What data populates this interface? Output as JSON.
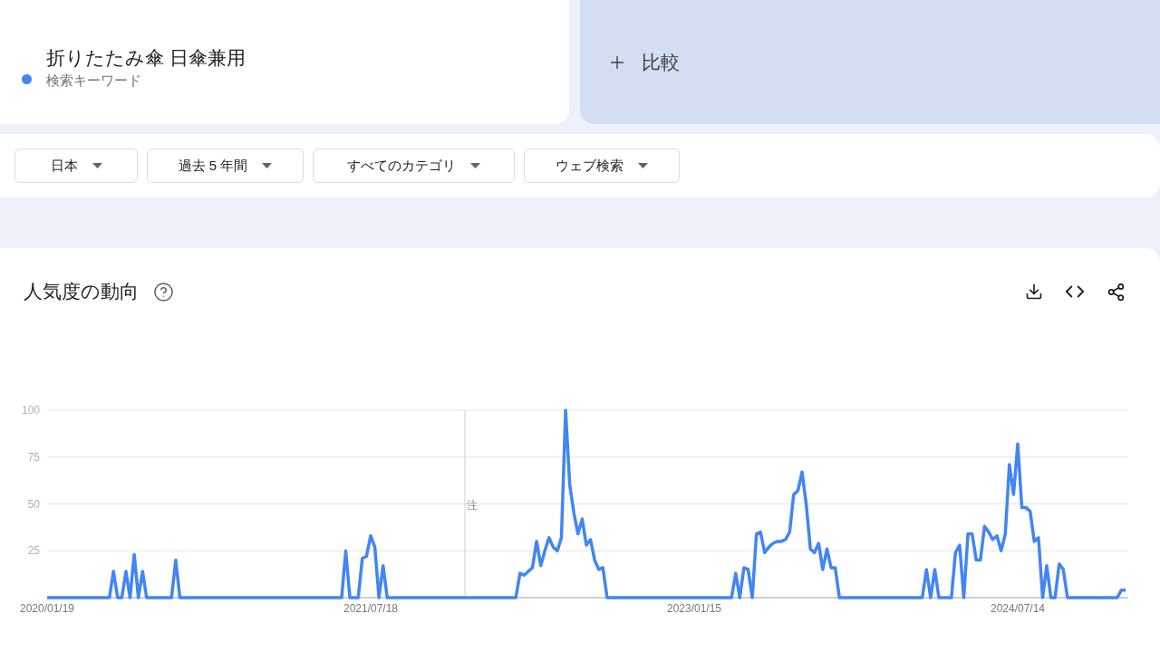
{
  "search_term": {
    "sublabel": "検索キーワード"
  },
  "compare": {
    "label": "比較"
  },
  "filters": [
    {
      "label": "日本"
    },
    {
      "label": "過去 5 年間"
    },
    {
      "label": "すべてのカテゴリ"
    },
    {
      "label": "ウェブ検索"
    }
  ],
  "chart": {
    "title": "人気度の動向",
    "chart_data": {
      "type": "line",
      "grid": true,
      "ylim": [
        0,
        100
      ],
      "yticks": [
        25,
        50,
        75,
        100
      ],
      "categories": [
        "2020/01/19",
        null,
        null,
        null,
        null,
        null,
        null,
        null,
        null,
        null,
        null,
        null,
        null,
        null,
        null,
        null,
        null,
        null,
        null,
        null,
        null,
        null,
        null,
        null,
        null,
        null,
        null,
        null,
        null,
        null,
        null,
        null,
        null,
        null,
        null,
        null,
        null,
        null,
        null,
        null,
        null,
        null,
        null,
        null,
        null,
        null,
        null,
        null,
        null,
        null,
        null,
        null,
        null,
        null,
        null,
        null,
        null,
        null,
        null,
        null,
        null,
        null,
        null,
        null,
        null,
        null,
        null,
        null,
        null,
        null,
        null,
        null,
        null,
        null,
        null,
        null,
        null,
        null,
        "2021/07/18",
        null,
        null,
        null,
        null,
        null,
        null,
        null,
        null,
        null,
        null,
        null,
        null,
        null,
        null,
        null,
        null,
        null,
        null,
        null,
        null,
        null,
        null,
        null,
        null,
        null,
        null,
        null,
        null,
        null,
        null,
        null,
        null,
        null,
        null,
        null,
        null,
        null,
        null,
        null,
        null,
        null,
        null,
        null,
        null,
        null,
        null,
        null,
        null,
        null,
        null,
        null,
        null,
        null,
        null,
        null,
        null,
        null,
        null,
        null,
        null,
        null,
        null,
        null,
        null,
        null,
        null,
        null,
        null,
        null,
        null,
        null,
        null,
        null,
        null,
        null,
        null,
        null,
        "2023/01/15",
        null,
        null,
        null,
        null,
        null,
        null,
        null,
        null,
        null,
        null,
        null,
        null,
        null,
        null,
        null,
        null,
        null,
        null,
        null,
        null,
        null,
        null,
        null,
        null,
        null,
        null,
        null,
        null,
        null,
        null,
        null,
        null,
        null,
        null,
        null,
        null,
        null,
        null,
        null,
        null,
        null,
        null,
        null,
        null,
        null,
        null,
        null,
        null,
        null,
        null,
        null,
        null,
        null,
        null,
        null,
        null,
        null,
        null,
        null,
        null,
        null,
        null,
        null,
        null,
        null,
        null,
        null,
        null,
        null,
        null,
        null,
        null,
        null,
        null,
        null,
        null,
        null,
        "2024/07/14",
        null,
        null,
        null,
        null,
        null,
        null,
        null,
        null,
        null,
        null,
        null,
        null,
        null,
        null,
        null,
        null,
        null,
        null,
        null,
        null,
        null,
        null,
        null,
        null,
        null,
        null
      ],
      "annotations": [
        "注"
      ],
      "series": [
        {
          "name": "折りたたみ傘 日傘兼用",
          "color": "#4285f4",
          "values": [
            0,
            0,
            0,
            0,
            0,
            0,
            0,
            0,
            0,
            0,
            0,
            0,
            0,
            0,
            0,
            0,
            14,
            0,
            0,
            14,
            0,
            23,
            0,
            14,
            0,
            0,
            0,
            0,
            0,
            0,
            0,
            20,
            0,
            0,
            0,
            0,
            0,
            0,
            0,
            0,
            0,
            0,
            0,
            0,
            0,
            0,
            0,
            0,
            0,
            0,
            0,
            0,
            0,
            0,
            0,
            0,
            0,
            0,
            0,
            0,
            0,
            0,
            0,
            0,
            0,
            0,
            0,
            0,
            0,
            0,
            0,
            0,
            25,
            0,
            0,
            0,
            21,
            22,
            33,
            27,
            0,
            17,
            0,
            0,
            0,
            0,
            0,
            0,
            0,
            0,
            0,
            0,
            0,
            0,
            0,
            0,
            0,
            0,
            0,
            0,
            0,
            0,
            0,
            0,
            0,
            0,
            0,
            0,
            0,
            0,
            0,
            0,
            0,
            0,
            13,
            12,
            14,
            16,
            30,
            17,
            25,
            32,
            27,
            25,
            32,
            100,
            60,
            45,
            34,
            42,
            28,
            31,
            20,
            15,
            16,
            0,
            0,
            0,
            0,
            0,
            0,
            0,
            0,
            0,
            0,
            0,
            0,
            0,
            0,
            0,
            0,
            0,
            0,
            0,
            0,
            0,
            0,
            0,
            0,
            0,
            0,
            0,
            0,
            0,
            0,
            0,
            13,
            0,
            16,
            15,
            0,
            34,
            35,
            24,
            27,
            29,
            30,
            30,
            31,
            35,
            55,
            57,
            67,
            50,
            26,
            24,
            29,
            15,
            26,
            16,
            16,
            0,
            0,
            0,
            0,
            0,
            0,
            0,
            0,
            0,
            0,
            0,
            0,
            0,
            0,
            0,
            0,
            0,
            0,
            0,
            0,
            0,
            15,
            0,
            15,
            0,
            0,
            0,
            0,
            24,
            28,
            0,
            34,
            34,
            20,
            20,
            38,
            35,
            31,
            33,
            25,
            34,
            71,
            55,
            82,
            48,
            48,
            46,
            30,
            32,
            0,
            17,
            0,
            0,
            18,
            15,
            0,
            0,
            0,
            0,
            0,
            0,
            0,
            0,
            0,
            0,
            0,
            0,
            0,
            4,
            4
          ]
        }
      ]
    }
  }
}
